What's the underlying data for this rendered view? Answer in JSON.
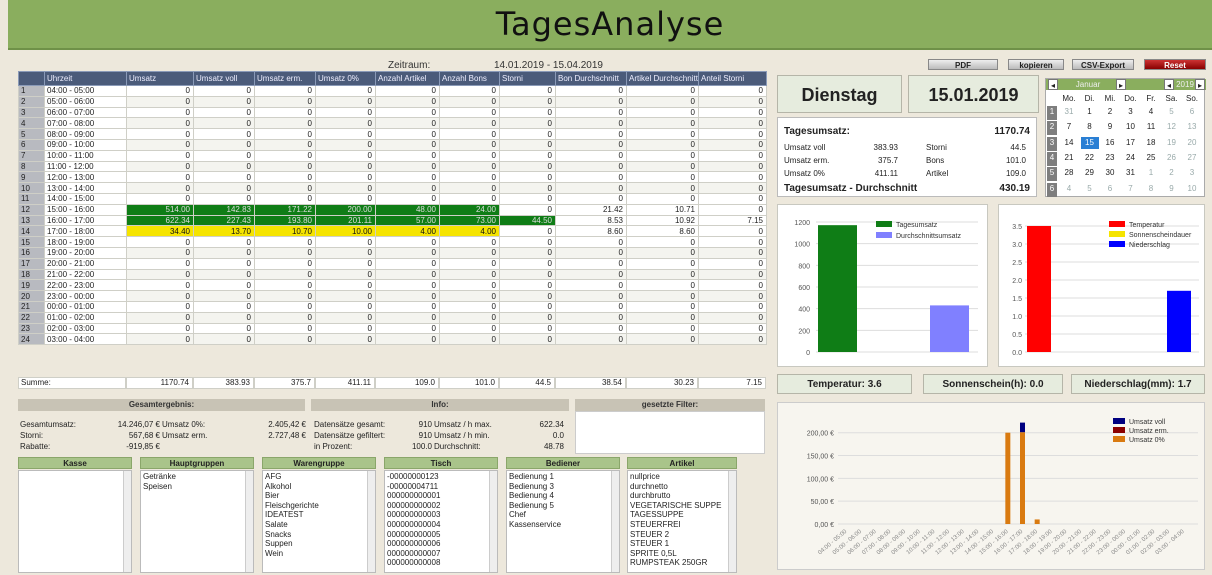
{
  "app": {
    "title": "TagesAnalyse"
  },
  "zeitraum": {
    "label": "Zeitraum:",
    "value": "14.01.2019 - 15.04.2019"
  },
  "buttons": {
    "pdf": "PDF",
    "kopieren": "kopieren",
    "csv": "CSV-Export",
    "reset": "Reset"
  },
  "grid": {
    "columns": [
      "Uhrzeit",
      "Umsatz",
      "Umsatz voll",
      "Umsatz erm.",
      "Umsatz 0%",
      "Anzahl Artikel",
      "Anzahl Bons",
      "Storni",
      "Bon Durchschnitt",
      "Artikel Durchschnitt",
      "Anteil Storni"
    ],
    "rows": [
      [
        "1",
        "04:00 - 05:00",
        "0",
        "0",
        "0",
        "0",
        "0",
        "0",
        "0",
        "0",
        "0",
        "0"
      ],
      [
        "2",
        "05:00 - 06:00",
        "0",
        "0",
        "0",
        "0",
        "0",
        "0",
        "0",
        "0",
        "0",
        "0"
      ],
      [
        "3",
        "06:00 - 07:00",
        "0",
        "0",
        "0",
        "0",
        "0",
        "0",
        "0",
        "0",
        "0",
        "0"
      ],
      [
        "4",
        "07:00 - 08:00",
        "0",
        "0",
        "0",
        "0",
        "0",
        "0",
        "0",
        "0",
        "0",
        "0"
      ],
      [
        "5",
        "08:00 - 09:00",
        "0",
        "0",
        "0",
        "0",
        "0",
        "0",
        "0",
        "0",
        "0",
        "0"
      ],
      [
        "6",
        "09:00 - 10:00",
        "0",
        "0",
        "0",
        "0",
        "0",
        "0",
        "0",
        "0",
        "0",
        "0"
      ],
      [
        "7",
        "10:00 - 11:00",
        "0",
        "0",
        "0",
        "0",
        "0",
        "0",
        "0",
        "0",
        "0",
        "0"
      ],
      [
        "8",
        "11:00 - 12:00",
        "0",
        "0",
        "0",
        "0",
        "0",
        "0",
        "0",
        "0",
        "0",
        "0"
      ],
      [
        "9",
        "12:00 - 13:00",
        "0",
        "0",
        "0",
        "0",
        "0",
        "0",
        "0",
        "0",
        "0",
        "0"
      ],
      [
        "10",
        "13:00 - 14:00",
        "0",
        "0",
        "0",
        "0",
        "0",
        "0",
        "0",
        "0",
        "0",
        "0"
      ],
      [
        "11",
        "14:00 - 15:00",
        "0",
        "0",
        "0",
        "0",
        "0",
        "0",
        "0",
        "0",
        "0",
        "0"
      ],
      [
        "12",
        "15:00 - 16:00",
        "514.00",
        "142.83",
        "171.22",
        "200.00",
        "48.00",
        "24.00",
        "0",
        "21.42",
        "10.71",
        "0"
      ],
      [
        "13",
        "16:00 - 17:00",
        "622.34",
        "227.43",
        "193.80",
        "201.11",
        "57.00",
        "73.00",
        "44.50",
        "8.53",
        "10.92",
        "7.15"
      ],
      [
        "14",
        "17:00 - 18:00",
        "34.40",
        "13.70",
        "10.70",
        "10.00",
        "4.00",
        "4.00",
        "0",
        "8.60",
        "8.60",
        "0"
      ],
      [
        "15",
        "18:00 - 19:00",
        "0",
        "0",
        "0",
        "0",
        "0",
        "0",
        "0",
        "0",
        "0",
        "0"
      ],
      [
        "16",
        "19:00 - 20:00",
        "0",
        "0",
        "0",
        "0",
        "0",
        "0",
        "0",
        "0",
        "0",
        "0"
      ],
      [
        "17",
        "20:00 - 21:00",
        "0",
        "0",
        "0",
        "0",
        "0",
        "0",
        "0",
        "0",
        "0",
        "0"
      ],
      [
        "18",
        "21:00 - 22:00",
        "0",
        "0",
        "0",
        "0",
        "0",
        "0",
        "0",
        "0",
        "0",
        "0"
      ],
      [
        "19",
        "22:00 - 23:00",
        "0",
        "0",
        "0",
        "0",
        "0",
        "0",
        "0",
        "0",
        "0",
        "0"
      ],
      [
        "20",
        "23:00 - 00:00",
        "0",
        "0",
        "0",
        "0",
        "0",
        "0",
        "0",
        "0",
        "0",
        "0"
      ],
      [
        "21",
        "00:00 - 01:00",
        "0",
        "0",
        "0",
        "0",
        "0",
        "0",
        "0",
        "0",
        "0",
        "0"
      ],
      [
        "22",
        "01:00 - 02:00",
        "0",
        "0",
        "0",
        "0",
        "0",
        "0",
        "0",
        "0",
        "0",
        "0"
      ],
      [
        "23",
        "02:00 - 03:00",
        "0",
        "0",
        "0",
        "0",
        "0",
        "0",
        "0",
        "0",
        "0",
        "0"
      ],
      [
        "24",
        "03:00 - 04:00",
        "0",
        "0",
        "0",
        "0",
        "0",
        "0",
        "0",
        "0",
        "0",
        "0"
      ]
    ],
    "summe": [
      "Summe:",
      "1170.74",
      "383.93",
      "375.7",
      "411.11",
      "109.0",
      "101.0",
      "44.5",
      "38.54",
      "30.23",
      "7.15"
    ]
  },
  "gesamt": {
    "title": "Gesamtergebnis:",
    "rows": [
      [
        "Gesamtumsatz:",
        "14.246,07 €",
        "Umsatz 0%:",
        "2.405,42 €"
      ],
      [
        "Storni:",
        "567,68 €",
        "Umsatz erm.",
        "2.727,48 €"
      ],
      [
        "Rabatte:",
        "-919,85 €",
        "",
        ""
      ]
    ]
  },
  "info": {
    "title": "Info:",
    "rows": [
      [
        "Datensätze gesamt:",
        "910",
        "Umsatz / h max.",
        "622.34"
      ],
      [
        "Datensätze gefiltert:",
        "910",
        "Umsatz / h min.",
        "0.0"
      ],
      [
        "in Prozent:",
        "100.0",
        "Durchschnitt:",
        "48.78"
      ]
    ]
  },
  "filter": {
    "title": "gesetzte Filter:"
  },
  "lists": [
    {
      "title": "Kasse",
      "items": []
    },
    {
      "title": "Hauptgruppen",
      "items": [
        "Getränke",
        "Speisen"
      ]
    },
    {
      "title": "Warengruppe",
      "items": [
        "AFG",
        "Alkohol",
        "Bier",
        "Fleischgerichte",
        "IDEATEST",
        "Salate",
        "Snacks",
        "Suppen",
        "Wein"
      ]
    },
    {
      "title": "Tisch",
      "items": [
        "-00000000123",
        "-00000004711",
        "000000000001",
        "000000000002",
        "000000000003",
        "000000000004",
        "000000000005",
        "000000000006",
        "000000000007",
        "000000000008"
      ]
    },
    {
      "title": "Bediener",
      "items": [
        "Bedienung 1",
        "Bedienung 3",
        "Bedienung 4",
        "Bedienung 5",
        "Chef",
        "Kassenservice"
      ]
    },
    {
      "title": "Artikel",
      "items": [
        "nullprice",
        "durchnetto",
        "durchbrutto",
        "VEGETARISCHE SUPPE",
        "TAGESSUPPE",
        "STEUERFREI",
        "STEUER 2",
        "STEUER 1",
        "SPRITE 0,5L",
        "RUMPSTEAK 250GR"
      ]
    }
  ],
  "day": {
    "weekday": "Dienstag",
    "date": "15.01.2019"
  },
  "tagesumsatz": {
    "label": "Tagesumsatz:",
    "value": "1170.74",
    "rows": [
      [
        "Umsatz voll",
        "383.93",
        "Storni",
        "44.5"
      ],
      [
        "Umsatz erm.",
        "375.7",
        "Bons",
        "101.0"
      ],
      [
        "Umsatz 0%",
        "411.11",
        "Artikel",
        "109.0"
      ]
    ],
    "avg_label": "Tagesumsatz - Durchschnitt",
    "avg_value": "430.19"
  },
  "calendar": {
    "month": "Januar",
    "year": "2019",
    "weekdays": [
      "Mo.",
      "Di.",
      "Mi.",
      "Do.",
      "Fr.",
      "Sa.",
      "So."
    ],
    "weeks": [
      [
        "1",
        "31",
        "1",
        "2",
        "3",
        "4",
        "5",
        "6"
      ],
      [
        "2",
        "7",
        "8",
        "9",
        "10",
        "11",
        "12",
        "13"
      ],
      [
        "3",
        "14",
        "15",
        "16",
        "17",
        "18",
        "19",
        "20"
      ],
      [
        "4",
        "21",
        "22",
        "23",
        "24",
        "25",
        "26",
        "27"
      ],
      [
        "5",
        "28",
        "29",
        "30",
        "31",
        "1",
        "2",
        "3"
      ],
      [
        "6",
        "4",
        "5",
        "6",
        "7",
        "8",
        "9",
        "10"
      ]
    ],
    "selected": "15"
  },
  "weather": {
    "temperatur": "Temperatur: 3.6",
    "sonnenschein": "Sonnenschein(h): 0.0",
    "niederschlag": "Niederschlag(mm): 1.7"
  },
  "colors": {
    "green": "#0f7d16",
    "yellow": "#f5e400",
    "header": "#8aae5e",
    "accent": "#4b5b7a"
  },
  "chart_data": [
    {
      "type": "bar",
      "series": [
        {
          "name": "Tagesumsatz",
          "values": [
            1170.74
          ],
          "color": "#0f7d16"
        },
        {
          "name": "Durchschnittsumsatz",
          "values": [
            430.19
          ],
          "color": "#8080ff"
        }
      ],
      "ylim": [
        0,
        1200
      ],
      "yticks": [
        "0",
        "200",
        "400",
        "600",
        "800",
        "1000",
        "1200"
      ]
    },
    {
      "type": "bar",
      "series": [
        {
          "name": "Temperatur",
          "values": [
            3.6
          ],
          "color": "#ff0000"
        },
        {
          "name": "Sonnenscheindauer",
          "values": [
            0.0
          ],
          "color": "#f5e400"
        },
        {
          "name": "Niederschlag",
          "values": [
            1.7
          ],
          "color": "#0000ff"
        }
      ],
      "ylim": [
        0,
        3.5
      ],
      "yticks": [
        "0.0",
        "0.5",
        "1.0",
        "1.5",
        "2.0",
        "2.5",
        "3.0",
        "3.5"
      ]
    },
    {
      "type": "bar",
      "categories": [
        "04:00 - 05:00",
        "05:00 - 06:00",
        "06:00 - 07:00",
        "07:00 - 08:00",
        "08:00 - 09:00",
        "09:00 - 10:00",
        "10:00 - 11:00",
        "11:00 - 12:00",
        "12:00 - 13:00",
        "13:00 - 14:00",
        "14:00 - 15:00",
        "15:00 - 16:00",
        "16:00 - 17:00",
        "17:00 - 18:00",
        "18:00 - 19:00",
        "19:00 - 20:00",
        "20:00 - 21:00",
        "21:00 - 22:00",
        "22:00 - 23:00",
        "23:00 - 00:00",
        "00:00 - 01:00",
        "01:00 - 02:00",
        "02:00 - 03:00",
        "03:00 - 04:00"
      ],
      "series": [
        {
          "name": "Umsatz 0%",
          "color": "#d97a10",
          "values": [
            0,
            0,
            0,
            0,
            0,
            0,
            0,
            0,
            0,
            0,
            0,
            200.0,
            201.11,
            10.0,
            0,
            0,
            0,
            0,
            0,
            0,
            0,
            0,
            0,
            0
          ]
        },
        {
          "name": "Umsatz erm.",
          "color": "#8b0000",
          "values": [
            0,
            0,
            0,
            0,
            0,
            0,
            0,
            0,
            0,
            0,
            0,
            0,
            0,
            0,
            0,
            0,
            0,
            0,
            0,
            0,
            0,
            0,
            0,
            0
          ]
        },
        {
          "name": "Umsatz voll",
          "color": "#000080",
          "values": [
            0,
            0,
            0,
            0,
            0,
            0,
            0,
            0,
            0,
            0,
            0,
            0,
            21.0,
            0,
            0,
            0,
            0,
            0,
            0,
            0,
            0,
            0,
            0,
            0
          ]
        }
      ],
      "ylim": [
        0,
        230
      ],
      "yticks": [
        "0,00 €",
        "50,00 €",
        "100,00 €",
        "150,00 €",
        "200,00 €"
      ]
    }
  ]
}
